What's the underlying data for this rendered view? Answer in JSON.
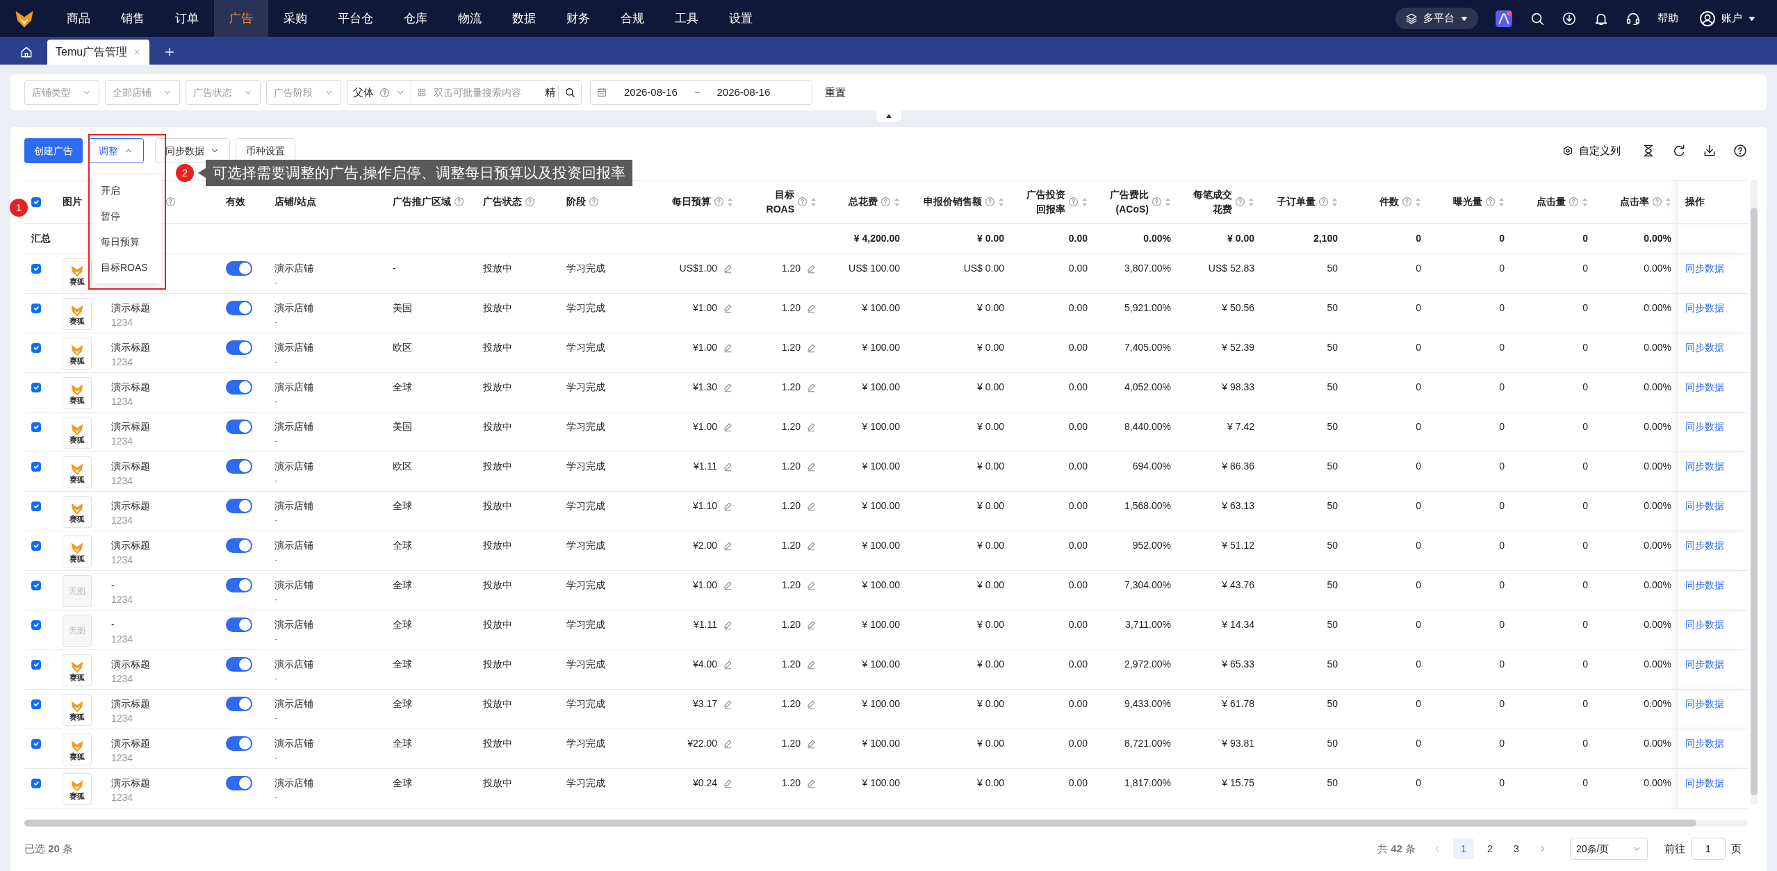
{
  "nav": {
    "items": [
      {
        "label": "商品",
        "selected": false
      },
      {
        "label": "销售",
        "selected": false
      },
      {
        "label": "订单",
        "selected": false
      },
      {
        "label": "广告",
        "selected": true
      },
      {
        "label": "采购",
        "selected": false
      },
      {
        "label": "平台仓",
        "selected": false
      },
      {
        "label": "仓库",
        "selected": false
      },
      {
        "label": "物流",
        "selected": false
      },
      {
        "label": "数据",
        "selected": false
      },
      {
        "label": "财务",
        "selected": false
      },
      {
        "label": "合规",
        "selected": false
      },
      {
        "label": "工具",
        "selected": false
      },
      {
        "label": "设置",
        "selected": false
      }
    ],
    "platform": "多平台",
    "help": "帮助",
    "account": "账户"
  },
  "tabs": [
    {
      "label": "Temu广告管理",
      "selected": true
    }
  ],
  "filters": {
    "selects": [
      "店铺类型",
      "全部店铺",
      "广告状态",
      "广告阶段"
    ],
    "search_type": "父体",
    "search_placeholder": "双击可批量搜索内容",
    "exact": "精",
    "date_start": "2026-08-16",
    "date_sep": "~",
    "date_end": "2026-08-16",
    "reset": "重置"
  },
  "toolbar": {
    "create": "创建广告",
    "adjust": {
      "label": "调整",
      "expanded": true
    },
    "sync": "同步数据",
    "currency": "币种设置",
    "columns": "自定义列"
  },
  "adjust_menu": [
    "开启",
    "暂停",
    "每日预算",
    "目标ROAS"
  ],
  "guide": {
    "badge_1": "1",
    "badge_2": "2",
    "tip": "可选择需要调整的广告,操作启停、调整每日预算以及投资回报率"
  },
  "table": {
    "select_all": true,
    "columns": [
      {
        "help": false,
        "sort": false
      },
      {
        "label": "图片",
        "help": false,
        "sort": false
      },
      {
        "help": true,
        "sort": false
      },
      {
        "label": "有效",
        "help": false,
        "sort": false
      },
      {
        "label": "店铺/站点",
        "help": false,
        "sort": false
      },
      {
        "label": "广告推广区域",
        "help": true,
        "sort": false
      },
      {
        "label": "广告状态",
        "help": true,
        "sort": false
      },
      {
        "label": "阶段",
        "help": true,
        "sort": false
      },
      {
        "label": "每日预算",
        "help": true,
        "sort": true
      },
      {
        "lines": [
          "目标",
          "ROAS"
        ],
        "help": true,
        "sort": true
      },
      {
        "label": "总花费",
        "help": true,
        "sort": true
      },
      {
        "label": "申报价销售额",
        "help": true,
        "sort": true
      },
      {
        "lines": [
          "广告投资",
          "回报率"
        ],
        "help": true,
        "sort": true
      },
      {
        "lines": [
          "广告费比",
          "(ACoS)"
        ],
        "help": true,
        "sort": true
      },
      {
        "lines": [
          "每笔成交",
          "花费"
        ],
        "help": true,
        "sort": true
      },
      {
        "label": "子订单量",
        "help": true,
        "sort": true
      },
      {
        "label": "件数",
        "help": true,
        "sort": true
      },
      {
        "label": "曝光量",
        "help": true,
        "sort": true
      },
      {
        "label": "点击量",
        "help": true,
        "sort": true
      },
      {
        "label": "点击率",
        "help": true,
        "sort": true
      },
      {
        "label": "操作",
        "help": false,
        "sort": false
      }
    ],
    "summary": {
      "label": "汇总",
      "values": [
        "¥ 4,200.00",
        "¥ 0.00",
        "0.00",
        "0.00%",
        "¥ 0.00",
        "2,100",
        "0",
        "0",
        "0",
        "0.00%"
      ]
    },
    "rows": [
      {
        "checked": true,
        "image": {
          "kind": "logo",
          "text": "赛狐"
        },
        "enabled": true,
        "shop": "演示店铺",
        "site": "-",
        "region": "-",
        "status": "投放中",
        "stage": "学习完成",
        "budget": "US$1.00",
        "roas": "1.20",
        "metrics": [
          "US$ 100.00",
          "US$ 0.00",
          "0.00",
          "3,807.00%",
          "US$ 52.83",
          "50",
          "0",
          "0",
          "0",
          "0.00%"
        ],
        "action": "同步数据"
      },
      {
        "checked": true,
        "image": {
          "kind": "logo",
          "text": "赛狐"
        },
        "title": "演示标题",
        "code": "1234",
        "enabled": true,
        "shop": "演示店铺",
        "site": "-",
        "region": "美国",
        "status": "投放中",
        "stage": "学习完成",
        "budget": "¥1.00",
        "roas": "1.20",
        "metrics": [
          "¥ 100.00",
          "¥ 0.00",
          "0.00",
          "5,921.00%",
          "¥ 50.56",
          "50",
          "0",
          "0",
          "0",
          "0.00%"
        ],
        "action": "同步数据"
      },
      {
        "checked": true,
        "image": {
          "kind": "logo",
          "text": "赛狐"
        },
        "title": "演示标题",
        "code": "1234",
        "enabled": true,
        "shop": "演示店铺",
        "site": "-",
        "region": "欧区",
        "status": "投放中",
        "stage": "学习完成",
        "budget": "¥1.00",
        "roas": "1.20",
        "metrics": [
          "¥ 100.00",
          "¥ 0.00",
          "0.00",
          "7,405.00%",
          "¥ 52.39",
          "50",
          "0",
          "0",
          "0",
          "0.00%"
        ],
        "action": "同步数据"
      },
      {
        "checked": true,
        "image": {
          "kind": "logo",
          "text": "赛狐"
        },
        "title": "演示标题",
        "code": "1234",
        "enabled": true,
        "shop": "演示店铺",
        "site": "-",
        "region": "全球",
        "status": "投放中",
        "stage": "学习完成",
        "budget": "¥1.30",
        "roas": "1.20",
        "metrics": [
          "¥ 100.00",
          "¥ 0.00",
          "0.00",
          "4,052.00%",
          "¥ 98.33",
          "50",
          "0",
          "0",
          "0",
          "0.00%"
        ],
        "action": "同步数据"
      },
      {
        "checked": true,
        "image": {
          "kind": "logo",
          "text": "赛狐"
        },
        "title": "演示标题",
        "code": "1234",
        "enabled": true,
        "shop": "演示店铺",
        "site": "-",
        "region": "美国",
        "status": "投放中",
        "stage": "学习完成",
        "budget": "¥1.00",
        "roas": "1.20",
        "metrics": [
          "¥ 100.00",
          "¥ 0.00",
          "0.00",
          "8,440.00%",
          "¥ 7.42",
          "50",
          "0",
          "0",
          "0",
          "0.00%"
        ],
        "action": "同步数据"
      },
      {
        "checked": true,
        "image": {
          "kind": "logo",
          "text": "赛狐"
        },
        "title": "演示标题",
        "code": "1234",
        "enabled": true,
        "shop": "演示店铺",
        "site": "-",
        "region": "欧区",
        "status": "投放中",
        "stage": "学习完成",
        "budget": "¥1.11",
        "roas": "1.20",
        "metrics": [
          "¥ 100.00",
          "¥ 0.00",
          "0.00",
          "694.00%",
          "¥ 86.36",
          "50",
          "0",
          "0",
          "0",
          "0.00%"
        ],
        "action": "同步数据"
      },
      {
        "checked": true,
        "image": {
          "kind": "logo",
          "text": "赛狐"
        },
        "title": "演示标题",
        "code": "1234",
        "enabled": true,
        "shop": "演示店铺",
        "site": "-",
        "region": "全球",
        "status": "投放中",
        "stage": "学习完成",
        "budget": "¥1.10",
        "roas": "1.20",
        "metrics": [
          "¥ 100.00",
          "¥ 0.00",
          "0.00",
          "1,568.00%",
          "¥ 63.13",
          "50",
          "0",
          "0",
          "0",
          "0.00%"
        ],
        "action": "同步数据"
      },
      {
        "checked": true,
        "image": {
          "kind": "logo",
          "text": "赛狐"
        },
        "title": "演示标题",
        "code": "1234",
        "enabled": true,
        "shop": "演示店铺",
        "site": "-",
        "region": "全球",
        "status": "投放中",
        "stage": "学习完成",
        "budget": "¥2.00",
        "roas": "1.20",
        "metrics": [
          "¥ 100.00",
          "¥ 0.00",
          "0.00",
          "952.00%",
          "¥ 51.12",
          "50",
          "0",
          "0",
          "0",
          "0.00%"
        ],
        "action": "同步数据"
      },
      {
        "checked": true,
        "image": {
          "kind": "empty",
          "text": "无图"
        },
        "title": "-",
        "code": "1234",
        "enabled": true,
        "shop": "演示店铺",
        "site": "-",
        "region": "全球",
        "status": "投放中",
        "stage": "学习完成",
        "budget": "¥1.00",
        "roas": "1.20",
        "metrics": [
          "¥ 100.00",
          "¥ 0.00",
          "0.00",
          "7,304.00%",
          "¥ 43.76",
          "50",
          "0",
          "0",
          "0",
          "0.00%"
        ],
        "action": "同步数据"
      },
      {
        "checked": true,
        "image": {
          "kind": "empty",
          "text": "无图"
        },
        "title": "-",
        "code": "1234",
        "enabled": true,
        "shop": "演示店铺",
        "site": "-",
        "region": "全球",
        "status": "投放中",
        "stage": "学习完成",
        "budget": "¥1.11",
        "roas": "1.20",
        "metrics": [
          "¥ 100.00",
          "¥ 0.00",
          "0.00",
          "3,711.00%",
          "¥ 14.34",
          "50",
          "0",
          "0",
          "0",
          "0.00%"
        ],
        "action": "同步数据"
      },
      {
        "checked": true,
        "image": {
          "kind": "logo",
          "text": "赛狐"
        },
        "title": "演示标题",
        "code": "1234",
        "enabled": true,
        "shop": "演示店铺",
        "site": "-",
        "region": "全球",
        "status": "投放中",
        "stage": "学习完成",
        "budget": "¥4.00",
        "roas": "1.20",
        "metrics": [
          "¥ 100.00",
          "¥ 0.00",
          "0.00",
          "2,972.00%",
          "¥ 65.33",
          "50",
          "0",
          "0",
          "0",
          "0.00%"
        ],
        "action": "同步数据"
      },
      {
        "checked": true,
        "image": {
          "kind": "logo",
          "text": "赛狐"
        },
        "title": "演示标题",
        "code": "1234",
        "enabled": true,
        "shop": "演示店铺",
        "site": "-",
        "region": "全球",
        "status": "投放中",
        "stage": "学习完成",
        "budget": "¥3.17",
        "roas": "1.20",
        "metrics": [
          "¥ 100.00",
          "¥ 0.00",
          "0.00",
          "9,433.00%",
          "¥ 61.78",
          "50",
          "0",
          "0",
          "0",
          "0.00%"
        ],
        "action": "同步数据"
      },
      {
        "checked": true,
        "image": {
          "kind": "logo",
          "text": "赛狐"
        },
        "title": "演示标题",
        "code": "1234",
        "enabled": true,
        "shop": "演示店铺",
        "site": "-",
        "region": "全球",
        "status": "投放中",
        "stage": "学习完成",
        "budget": "¥22.00",
        "roas": "1.20",
        "metrics": [
          "¥ 100.00",
          "¥ 0.00",
          "0.00",
          "8,721.00%",
          "¥ 93.81",
          "50",
          "0",
          "0",
          "0",
          "0.00%"
        ],
        "action": "同步数据"
      },
      {
        "checked": true,
        "image": {
          "kind": "logo",
          "text": "赛狐"
        },
        "title": "演示标题",
        "code": "1234",
        "enabled": true,
        "shop": "演示店铺",
        "site": "-",
        "region": "全球",
        "status": "投放中",
        "stage": "学习完成",
        "budget": "¥0.24",
        "roas": "1.20",
        "metrics": [
          "¥ 100.00",
          "¥ 0.00",
          "0.00",
          "1,817.00%",
          "¥ 15.75",
          "50",
          "0",
          "0",
          "0",
          "0.00%"
        ],
        "action": "同步数据"
      }
    ]
  },
  "footer": {
    "selected": "已选 **20** 条",
    "total": "共 **42** 条",
    "pages": [
      {
        "label": "1",
        "selected": true
      },
      {
        "label": "2",
        "selected": false
      },
      {
        "label": "3",
        "selected": false
      }
    ],
    "page_size": "20条/页",
    "goto": "前往",
    "goto_value": "1",
    "page_unit": "页"
  }
}
